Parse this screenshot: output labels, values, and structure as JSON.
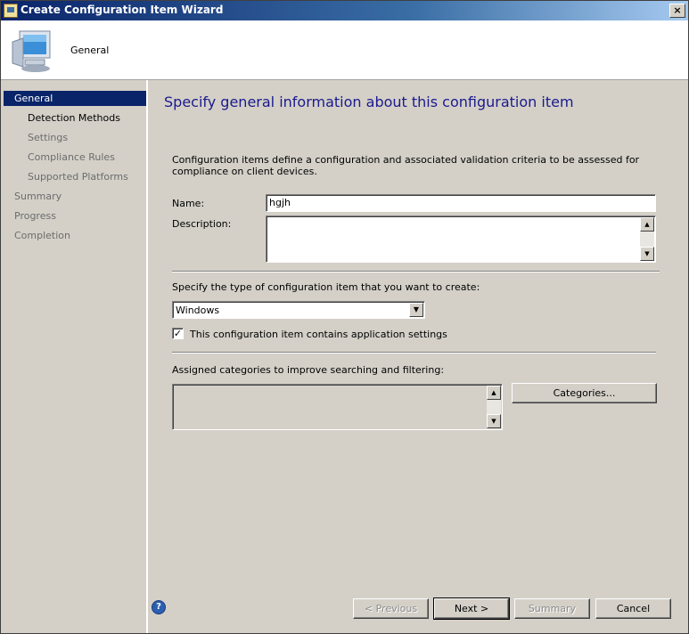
{
  "window": {
    "title": "Create Configuration Item Wizard",
    "close_glyph": "×"
  },
  "header": {
    "title": "General",
    "icon": "computer-monitor-icon"
  },
  "nav": {
    "items": [
      {
        "label": "General"
      },
      {
        "label": "Detection Methods"
      },
      {
        "label": "Settings"
      },
      {
        "label": "Compliance Rules"
      },
      {
        "label": "Supported Platforms"
      },
      {
        "label": "Summary"
      },
      {
        "label": "Progress"
      },
      {
        "label": "Completion"
      }
    ]
  },
  "page": {
    "heading": "Specify general information about this configuration item",
    "intro": "Configuration items define a configuration and associated validation criteria to be assessed for compliance on client devices.",
    "name_label": "Name:",
    "name_value": "hgjh",
    "description_label": "Description:",
    "description_value": "",
    "type_label": "Specify the type of configuration item that you want to create:",
    "type_value": "Windows",
    "app_settings_label": "This configuration item contains application settings",
    "app_settings_checked": true,
    "categories_label": "Assigned categories to improve searching and filtering:",
    "categories_button": "Categories..."
  },
  "footer": {
    "previous": "< Previous",
    "next": "Next >",
    "summary": "Summary",
    "cancel": "Cancel",
    "help_icon": "help-icon"
  }
}
